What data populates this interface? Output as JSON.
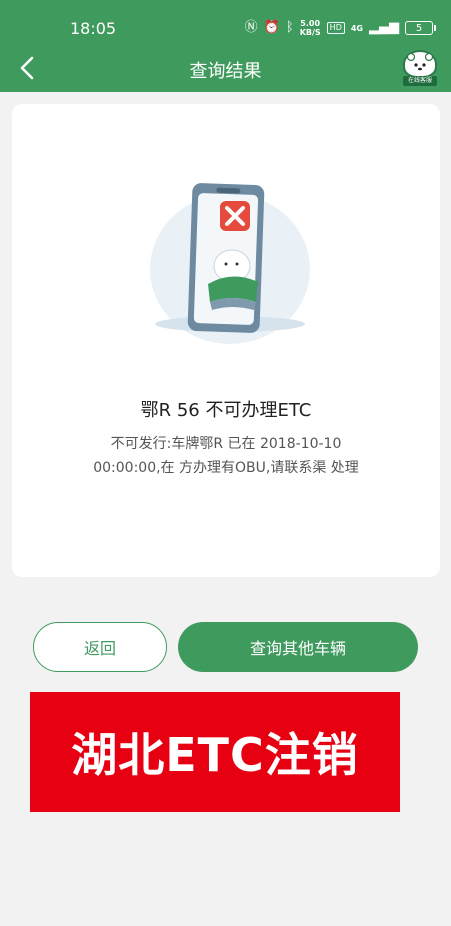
{
  "status_bar": {
    "time": "18:05",
    "net_speed": "5.00",
    "net_unit": "KB/S",
    "hd": "HD",
    "signal": "4G",
    "battery": "5"
  },
  "header": {
    "title": "查询结果",
    "customer_service_label": "在线客服"
  },
  "result": {
    "title": "鄂R 56  不可办理ETC",
    "description": "不可发行:车牌鄂R 已在 2018-10-10 00:00:00,在 方办理有OBU,请联系渠 处理"
  },
  "buttons": {
    "back": "返回",
    "query_other": "查询其他车辆"
  },
  "banner": {
    "text": "湖北ETC注销"
  },
  "colors": {
    "primary": "#3f9a5e",
    "banner": "#e60012",
    "error": "#e64a3c"
  }
}
